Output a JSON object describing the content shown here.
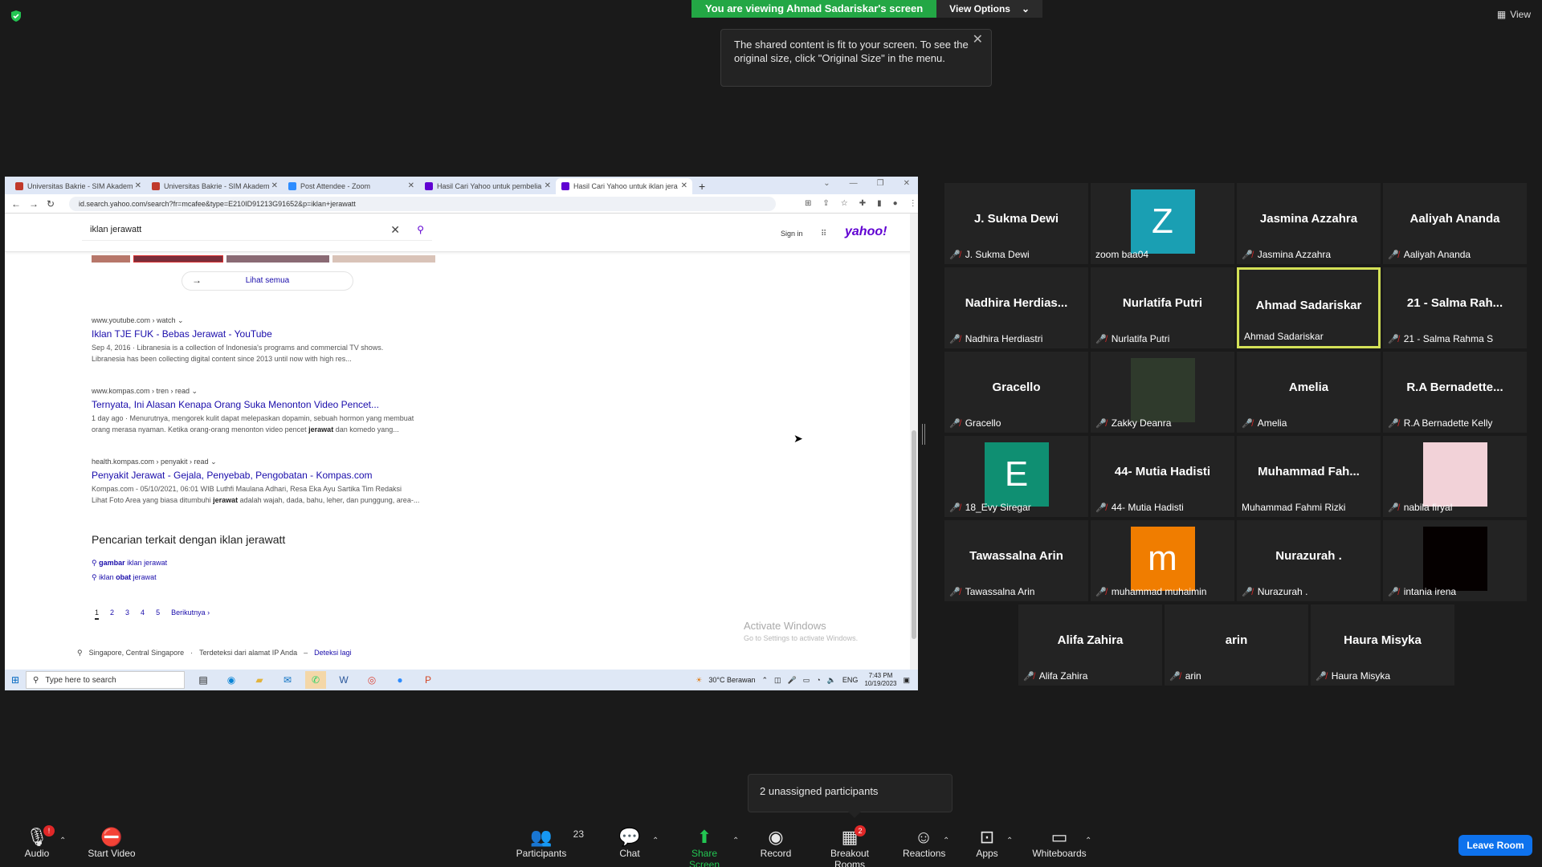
{
  "banner": {
    "viewing": "You are viewing Ahmad Sadariskar's screen",
    "view_options": "View Options",
    "view": "View"
  },
  "tooltip": {
    "text": "The shared content is fit to your screen. To see the original size, click \"Original Size\" in the menu."
  },
  "browser": {
    "tabs": [
      {
        "label": "Universitas Bakrie - SIM Akadem",
        "color": "#c0392b"
      },
      {
        "label": "Universitas Bakrie - SIM Akadem",
        "color": "#c0392b"
      },
      {
        "label": "Post Attendee - Zoom",
        "color": "#2d8cff"
      },
      {
        "label": "Hasil Cari Yahoo untuk pembelia",
        "color": "#6001d2"
      },
      {
        "label": "Hasil Cari Yahoo untuk iklan jera",
        "color": "#6001d2"
      }
    ],
    "url": "id.search.yahoo.com/search?fr=mcafee&type=E210ID91213G91652&p=iklan+jerawatt"
  },
  "yahoo": {
    "query": "iklan jerawatt",
    "sign_in": "Sign in",
    "logo": "yahoo!",
    "lihat_semua": "Lihat semua",
    "results": [
      {
        "source": "www.youtube.com › watch ⌄",
        "title": "Iklan TJE FUK - Bebas Jerawat - YouTube",
        "desc1": "Sep 4, 2016 · Libranesia is a collection of Indonesia's programs and commercial TV shows.",
        "desc2": "Libranesia has been collecting digital content since 2013 until now with high res..."
      },
      {
        "source": "www.kompas.com › tren › read ⌄",
        "title": "Ternyata, Ini Alasan Kenapa Orang Suka Menonton Video Pencet...",
        "desc1": "1 day ago · Menurutnya, mengorek kulit dapat melepaskan dopamin, sebuah hormon yang membuat",
        "desc2a": "orang merasa nyaman. Ketika orang-orang menonton video pencet ",
        "desc2b": "jerawat",
        "desc2c": " dan komedo yang..."
      },
      {
        "source": "health.kompas.com › penyakit › read ⌄",
        "title": "Penyakit Jerawat - Gejala, Penyebab, Pengobatan - Kompas.com",
        "desc1": "Kompas.com - 05/10/2021, 06:01 WIB Luthfi Maulana Adhari, Resa Eka Ayu Sartika Tim Redaksi",
        "desc2a": "Lihat Foto Area yang biasa ditumbuhi ",
        "desc2b": "jerawat",
        "desc2c": " adalah wajah, dada, bahu, leher, dan punggung, area-..."
      }
    ],
    "related_heading": "Pencarian terkait dengan iklan jerawatt",
    "related": [
      {
        "bold": "gambar",
        "rest": " iklan jerawat"
      },
      {
        "bold": "obat",
        "pre": "iklan ",
        "rest": " jerawat"
      }
    ],
    "pages": [
      "1",
      "2",
      "3",
      "4",
      "5"
    ],
    "next": "Berikutnya",
    "location": "Singapore, Central Singapore",
    "location_note": "Terdeteksi dari alamat IP Anda",
    "detect_again": "Deteksi lagi"
  },
  "activate": {
    "title": "Activate Windows",
    "sub": "Go to Settings to activate Windows."
  },
  "taskbar": {
    "search": "Type here to search",
    "weather": "30°C  Berawan",
    "lang": "ENG",
    "time": "7:43 PM",
    "date": "10/19/2023"
  },
  "participants": [
    {
      "name": "J. Sukma Dewi",
      "label": "J. Sukma Dewi",
      "muted": true
    },
    {
      "name": "",
      "label": "zoom baa04",
      "muted": false,
      "avatar": "Z",
      "avatar_color": "#1a9fb3"
    },
    {
      "name": "Jasmina Azzahra",
      "label": "Jasmina Azzahra",
      "muted": true
    },
    {
      "name": "Aaliyah Ananda",
      "label": "Aaliyah Ananda",
      "muted": true
    },
    {
      "name": "Nadhira  Herdias...",
      "label": "Nadhira Herdiastri",
      "muted": true
    },
    {
      "name": "Nurlatifa Putri",
      "label": "Nurlatifa Putri",
      "muted": true
    },
    {
      "name": "Ahmad Sadariskar",
      "label": "Ahmad Sadariskar",
      "muted": false,
      "active": true
    },
    {
      "name": "21 - Salma Rah...",
      "label": "21 - Salma Rahma S",
      "muted": true
    },
    {
      "name": "Gracello",
      "label": "Gracello",
      "muted": true
    },
    {
      "name": "",
      "label": "Zakky Deanra",
      "muted": true,
      "photo": "#2f3a2c"
    },
    {
      "name": "Amelia",
      "label": "Amelia",
      "muted": true
    },
    {
      "name": "R.A  Bernadette...",
      "label": "R.A Bernadette Kelly",
      "muted": true
    },
    {
      "name": "",
      "label": "18_Evy Siregar",
      "muted": true,
      "avatar": "E",
      "avatar_color": "#0f8f72"
    },
    {
      "name": "44- Mutia Hadisti",
      "label": "44- Mutia Hadisti",
      "muted": true
    },
    {
      "name": "Muhammad  Fah...",
      "label": "Muhammad Fahmi Rizki",
      "muted": false
    },
    {
      "name": "",
      "label": "nabila firyal",
      "muted": true,
      "photo": "#f2d2d8"
    },
    {
      "name": "Tawassalna Arin",
      "label": "Tawassalna Arin",
      "muted": true
    },
    {
      "name": "",
      "label": "muhammad muhaimin",
      "muted": true,
      "avatar": "m",
      "avatar_color": "#f07d00"
    },
    {
      "name": "Nurazurah .",
      "label": "Nurazurah .",
      "muted": true
    },
    {
      "name": "",
      "label": "intania irena",
      "muted": true,
      "photo": "#050000"
    },
    {
      "name": "Alifa Zahira",
      "label": "Alifa Zahira",
      "muted": true
    },
    {
      "name": "arin",
      "label": "arin",
      "muted": true
    },
    {
      "name": "Haura Misyka",
      "label": "Haura Misyka",
      "muted": true
    }
  ],
  "notice": "2 unassigned participants",
  "toolbar": {
    "audio": "Audio",
    "audio_badge": "!",
    "start_video": "Start Video",
    "participants": "Participants",
    "participants_count": "23",
    "chat": "Chat",
    "share_screen": "Share Screen",
    "record": "Record",
    "breakout_rooms": "Breakout Rooms",
    "breakout_badge": "2",
    "reactions": "Reactions",
    "apps": "Apps",
    "whiteboards": "Whiteboards",
    "leave": "Leave Room"
  },
  "colors": {
    "share_green": "#23c552",
    "banner_green": "#23a745",
    "leave_blue": "#0e72ed",
    "active_border": "#d4e157",
    "muted_red": "#e02828"
  }
}
